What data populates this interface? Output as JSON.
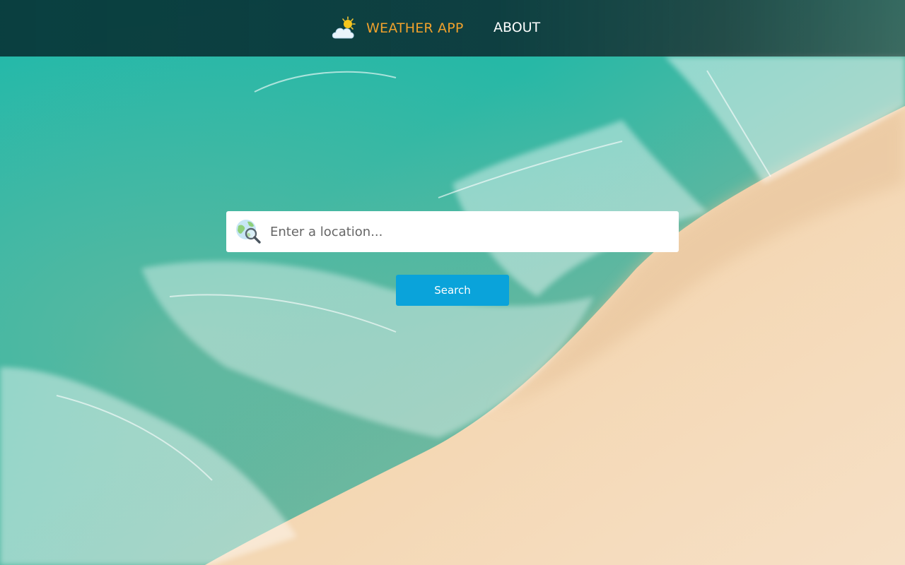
{
  "nav": {
    "brand_label": "WEATHER APP",
    "about_label": "ABOUT",
    "brand_icon": "sun-cloud-icon"
  },
  "search": {
    "placeholder": "Enter a location...",
    "value": "",
    "icon": "globe-search-icon",
    "button_label": "Search"
  },
  "colors": {
    "brand_accent": "#f0a12c",
    "button": "#0aa3da",
    "nav_text": "#ffffff"
  }
}
